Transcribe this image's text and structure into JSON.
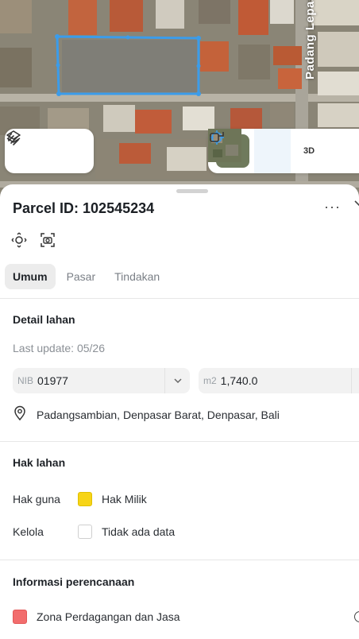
{
  "map": {
    "road_label": "Padang Lepas",
    "selection_color": "#3b9cea",
    "view_buttons": {
      "three_d_label": "3D"
    },
    "icons": [
      "layers-icon",
      "measure-icon",
      "satellite-thumb",
      "locate-crosshair-icon",
      "compare-icon"
    ]
  },
  "parcel": {
    "title": "Parcel ID: 102545234",
    "more_label": "···",
    "tabs": [
      {
        "label": "Umum",
        "active": true
      },
      {
        "label": "Pasar",
        "active": false
      },
      {
        "label": "Tindakan",
        "active": false
      }
    ]
  },
  "detail": {
    "heading": "Detail lahan",
    "last_update": "Last update: 05/26",
    "nib_prefix": "NIB",
    "nib_value": "01977",
    "area_prefix": "m2",
    "area_value": "1,740.0",
    "address": "Padangsambian, Denpasar Barat, Denpasar, Bali"
  },
  "rights": {
    "heading": "Hak lahan",
    "rows": [
      {
        "label": "Hak guna",
        "value": "Hak Milik",
        "color": "#f7d417"
      },
      {
        "label": "Kelola",
        "value": "Tidak ada data",
        "color": "#ffffff"
      }
    ]
  },
  "planning": {
    "heading": "Informasi perencanaan",
    "zone": {
      "label": "Zona Perdagangan dan Jasa",
      "color": "#f26d6d"
    }
  }
}
